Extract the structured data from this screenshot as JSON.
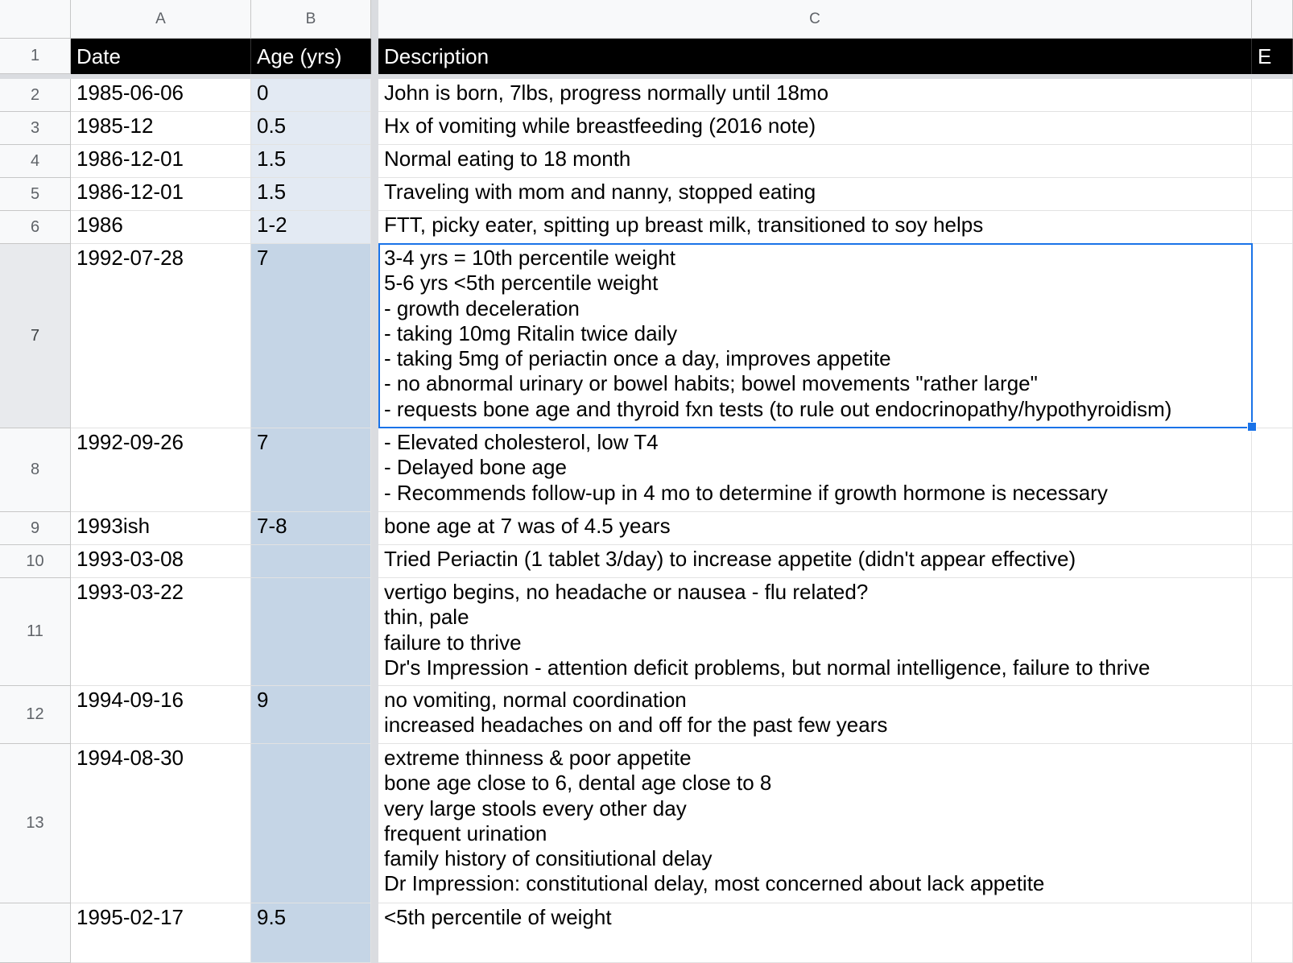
{
  "columns": [
    {
      "letter": "A"
    },
    {
      "letter": "B"
    },
    {
      "letter": "C"
    }
  ],
  "header_row": {
    "row_number": "1",
    "date": "Date",
    "age": "Age (yrs)",
    "description": "Description",
    "next_col_partial": "E"
  },
  "rows": [
    {
      "num": "2",
      "date": "1985-06-06",
      "age": "0",
      "description": "John is born, 7lbs, progress normally until 18mo"
    },
    {
      "num": "3",
      "date": "1985-12",
      "age": "0.5",
      "description": "Hx of vomiting while breastfeeding (2016 note)"
    },
    {
      "num": "4",
      "date": "1986-12-01",
      "age": "1.5",
      "description": "Normal eating to 18 month"
    },
    {
      "num": "5",
      "date": "1986-12-01",
      "age": "1.5",
      "description": "Traveling with mom and nanny, stopped eating"
    },
    {
      "num": "6",
      "date": "1986",
      "age": "1-2",
      "description": "FTT, picky eater, spitting up breast milk, transitioned to soy helps"
    },
    {
      "num": "7",
      "date": "1992-07-28",
      "age": "7",
      "description": "3-4 yrs = 10th percentile weight\n5-6 yrs <5th percentile weight\n- growth deceleration\n- taking 10mg Ritalin twice daily\n- taking 5mg of periactin once a day, improves appetite\n- no abnormal urinary or bowel habits; bowel movements \"rather large\"\n- requests bone age and thyroid fxn tests (to rule out endocrinopathy/hypothyroidism)"
    },
    {
      "num": "8",
      "date": "1992-09-26",
      "age": "7",
      "description": "- Elevated cholesterol, low T4\n- Delayed bone age\n- Recommends follow-up in 4 mo to determine if growth hormone is necessary"
    },
    {
      "num": "9",
      "date": "1993ish",
      "age": "7-8",
      "description": "bone age at 7 was of 4.5 years"
    },
    {
      "num": "10",
      "date": "1993-03-08",
      "age": "",
      "description": "Tried Periactin (1 tablet 3/day) to increase appetite (didn't appear effective)"
    },
    {
      "num": "11",
      "date": "1993-03-22",
      "age": "",
      "description": "vertigo begins, no headache or nausea - flu related?\nthin, pale\nfailure to thrive\nDr's Impression - attention deficit problems, but normal intelligence, failure to thrive"
    },
    {
      "num": "12",
      "date": "1994-09-16",
      "age": "9",
      "description": "no vomiting, normal coordination\nincreased headaches on and off for the past few years"
    },
    {
      "num": "13",
      "date": "1994-08-30",
      "age": "",
      "description": "extreme thinness & poor appetite\nbone age close to 6, dental age close to 8\nvery large stools every other day\nfrequent urination\nfamily history of consitiutional delay\nDr Impression: constitutional delay, most concerned about lack appetite"
    },
    {
      "num": "",
      "date": "1995-02-17",
      "age": "9.5",
      "description": "<5th percentile of weight"
    }
  ],
  "selected_cell": "C7",
  "colors": {
    "header_bg": "#000000",
    "header_text": "#ffffff",
    "age_col_light": "#e3eaf3",
    "age_col_dark": "#c5d5e6",
    "selection": "#1a73e8",
    "grid_header_bg": "#f8f9fa"
  }
}
